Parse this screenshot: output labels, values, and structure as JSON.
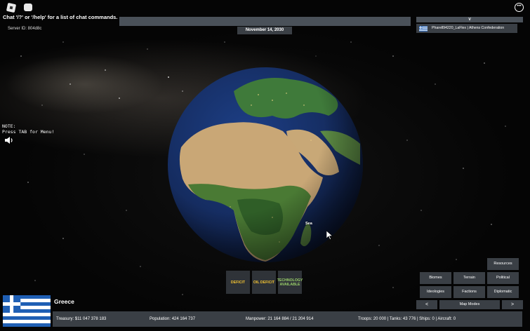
{
  "chat": {
    "message": "Chat '/?' or '/help' for a list of chat commands.",
    "server_id": "Server ID: 804d8c"
  },
  "header": {
    "date": "November 14, 2030",
    "toggle_glyph": "∨",
    "player": "Pharell94220_LaFlex  |  Athens Confederation"
  },
  "note": {
    "text": "NOTE:\nPress TAB for Menu!"
  },
  "map": {
    "sea_label": "Sea"
  },
  "alerts": {
    "deficit": "DEFICIT",
    "oil_deficit": "OIL DEFICIT",
    "technology": "TECHNOLOGY AVAILABLE"
  },
  "map_modes": {
    "resources": "Resources",
    "biomes": "Biomes",
    "terrain": "Terrain",
    "political": "Political",
    "ideologies": "Ideologies",
    "factions": "Factions",
    "diplomatic": "Diplomatic",
    "prev": "<",
    "label": "Map Modes",
    "next": ">"
  },
  "country": {
    "name": "Greece",
    "treasury": "Treasury:  $11 047 378 183",
    "population": "Population: 424 164 737",
    "manpower": "Manpower:  21 164 884  /  21 204 914",
    "military": "Troops: 20 000  |  Tanks: 43 776  |  Ships: 0  |  Aircraft: 0"
  },
  "colors": {
    "greece_blue": "#1f5fb4",
    "panel": "#3a3f45",
    "warning": "#f1c232",
    "positive": "#9ad06a"
  }
}
